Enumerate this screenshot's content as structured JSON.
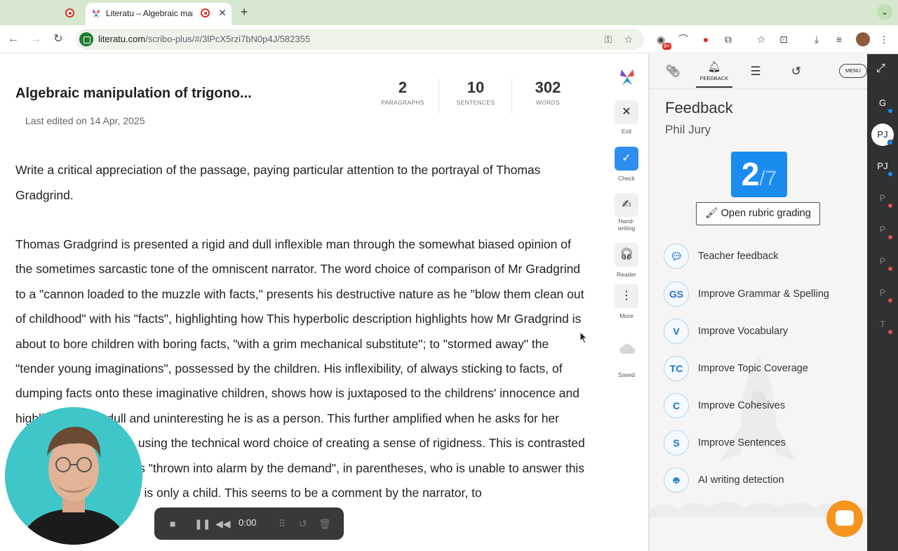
{
  "browser": {
    "tab_title": "Literatu – Algebraic manip",
    "url_host": "literatu.com",
    "url_path": "/scribo-plus/#/3lPcX5rzi7bN0p4J/582355",
    "extension_badge": "9+"
  },
  "doc": {
    "title": "Algebraic manipulation of trigono...",
    "last_edited": "Last edited on 14 Apr, 2025",
    "stats": [
      {
        "value": "2",
        "label": "PARAGRAPHS"
      },
      {
        "value": "10",
        "label": "SENTENCES"
      },
      {
        "value": "302",
        "label": "WORDS"
      }
    ],
    "prompt": "Write a critical appreciation of the passage, paying particular attention to the portrayal of Thomas Gradgrind.",
    "essay": "Thomas Gradgrind is presented a rigid and dull inflexible man through the somewhat biased opinion of the sometimes sarcastic tone of the omniscent narrator. The word choice of comparison of Mr Gradgrind to a \"cannon loaded to the muzzle with facts,\" presents his destructive nature as he \"blow them clean out of childhood\" with his \"facts\", highlighting how This hyperbolic description highlights how Mr Gradgrind is about to bore children with boring facts, \"with a grim mechanical substitute\"; to \"stormed away\" the \"tender young imaginations\", possessed by the children. His inflexibility, of always sticking to facts, of dumping facts onto these imaginative children, shows how is juxtaposed to the childrens' innocence and highlighting how dull and uninteresting he is as a person. This further amplified when he asks for her \"definition of a horse\", using the technical word choice of creating a sense of rigidness. This is contrasted to the poor girl who was \"thrown into alarm by the demand\", in parentheses, who is unable to answer this difficult demand as she is only a child. This seems to be a comment by the narrator, to"
  },
  "tools": {
    "exit": "Exit",
    "check": "Check",
    "handwriting": "Hand-\nwriting",
    "reader": "Reader",
    "more": "More",
    "saved": "Saved"
  },
  "panel": {
    "tab_feedback": "FEEDBACK",
    "menu": "MENU",
    "title": "Feedback",
    "teacher_name": "Phil Jury",
    "score": "2",
    "score_total": "/7",
    "rubric_button": "Open rubric grading",
    "items": [
      {
        "abbr": "",
        "label": "Teacher feedback"
      },
      {
        "abbr": "GS",
        "label": "Improve Grammar & Spelling"
      },
      {
        "abbr": "V",
        "label": "Improve Vocabulary"
      },
      {
        "abbr": "TC",
        "label": "Improve Topic Coverage"
      },
      {
        "abbr": "C",
        "label": "Improve Cohesives"
      },
      {
        "abbr": "S",
        "label": "Improve Sentences"
      },
      {
        "abbr": "",
        "label": "AI writing detection"
      }
    ]
  },
  "rail": {
    "avatars": [
      {
        "initials": "G",
        "style": "dark",
        "dot": "#1a8cf0"
      },
      {
        "initials": "PJ",
        "style": "white",
        "dot": "#1a8cf0"
      },
      {
        "initials": "PJ",
        "style": "dark",
        "dot": "#1a8cf0"
      },
      {
        "initials": "P",
        "style": "dim",
        "dot": "#d9534f"
      },
      {
        "initials": "P",
        "style": "dim",
        "dot": "#d9534f"
      },
      {
        "initials": "P",
        "style": "dim",
        "dot": "#d9534f"
      },
      {
        "initials": "P",
        "style": "dim",
        "dot": "#d9534f"
      },
      {
        "initials": "T",
        "style": "dim",
        "dot": "#d9534f"
      }
    ]
  },
  "recorder": {
    "time": "0:00"
  },
  "colors": {
    "accent": "#1a8cf0",
    "check": "#2d8ef0",
    "chat": "#f7941d",
    "webcam_bg": "#3fc6c9"
  }
}
